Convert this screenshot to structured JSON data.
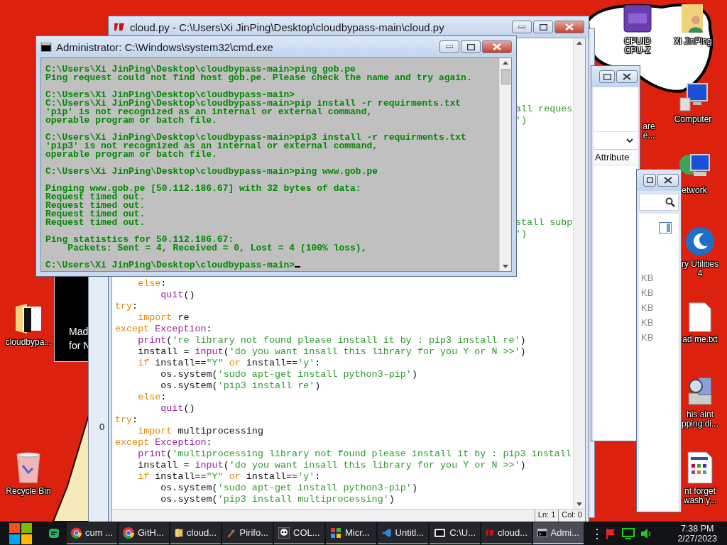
{
  "desktop_icons": [
    {
      "kind": "cpu-chip",
      "label": "CPUID\nCPU-Z"
    },
    {
      "kind": "user-folder",
      "label": "Xi JinPing"
    },
    {
      "kind": "hidden",
      "label": "are\ne..."
    },
    {
      "kind": "computer",
      "label": "Computer"
    },
    {
      "kind": "globe-computer",
      "label": "etwork"
    },
    {
      "kind": "swirl",
      "label": "ry Utilities\n4"
    },
    {
      "kind": "text-file",
      "label": "ad me.txt"
    },
    {
      "kind": "scanner",
      "label": "his aint\npping di..."
    },
    {
      "kind": "document",
      "label": "nt forget\nwash y..."
    },
    {
      "kind": "folder",
      "label": "cloudbypa..."
    },
    {
      "kind": "recycle-bin",
      "label": "Recycle Bin"
    }
  ],
  "background_windows": {
    "promo_text": [
      "Mad",
      "for N"
    ],
    "side_value": "0",
    "attribute_header": "Attribute",
    "sizes": [
      "KB",
      "KB",
      "KB",
      "KB",
      "KB"
    ]
  },
  "editor": {
    "title": "cloud.py - C:\\Users\\Xi JinPing\\Desktop\\cloudbypass-main\\cloud.py",
    "fragments": [
      [
        "all reques",
        "')"
      ],
      [
        "stall subp",
        "')"
      ]
    ],
    "lines": [
      [
        {
          "kind": "keyword",
          "text": "    else"
        },
        {
          "kind": "plain",
          "text": ":"
        }
      ],
      [
        {
          "kind": "builtin",
          "text": "        quit"
        },
        {
          "kind": "plain",
          "text": "()"
        }
      ],
      [
        {
          "kind": "keyword",
          "text": "try"
        },
        {
          "kind": "plain",
          "text": ":"
        }
      ],
      [
        {
          "kind": "keyword",
          "text": "    import"
        },
        {
          "kind": "plain",
          "text": " re"
        }
      ],
      [
        {
          "kind": "keyword",
          "text": "except"
        },
        {
          "kind": "builtin",
          "text": " Exception"
        },
        {
          "kind": "plain",
          "text": ":"
        }
      ],
      [
        {
          "kind": "builtin",
          "text": "    print"
        },
        {
          "kind": "plain",
          "text": "("
        },
        {
          "kind": "string",
          "text": "'re library not found please install it by : pip3 install re'"
        },
        {
          "kind": "plain",
          "text": ")"
        }
      ],
      [
        {
          "kind": "plain",
          "text": "    install = "
        },
        {
          "kind": "builtin",
          "text": "input"
        },
        {
          "kind": "plain",
          "text": "("
        },
        {
          "kind": "string",
          "text": "'do you want insall this library for you Y or N >>'"
        },
        {
          "kind": "plain",
          "text": ")"
        }
      ],
      [
        {
          "kind": "keyword",
          "text": "    if"
        },
        {
          "kind": "plain",
          "text": " install=="
        },
        {
          "kind": "string",
          "text": "\"Y\""
        },
        {
          "kind": "keyword",
          "text": " or"
        },
        {
          "kind": "plain",
          "text": " install=="
        },
        {
          "kind": "string",
          "text": "'y'"
        },
        {
          "kind": "plain",
          "text": ":"
        }
      ],
      [
        {
          "kind": "plain",
          "text": "        os.system("
        },
        {
          "kind": "string",
          "text": "'sudo apt-get install python3-pip'"
        },
        {
          "kind": "plain",
          "text": ")"
        }
      ],
      [
        {
          "kind": "plain",
          "text": "        os.system("
        },
        {
          "kind": "string",
          "text": "'pip3 install re'"
        },
        {
          "kind": "plain",
          "text": ")"
        }
      ],
      [
        {
          "kind": "keyword",
          "text": "    else"
        },
        {
          "kind": "plain",
          "text": ":"
        }
      ],
      [
        {
          "kind": "builtin",
          "text": "        quit"
        },
        {
          "kind": "plain",
          "text": "()"
        }
      ],
      [
        {
          "kind": "keyword",
          "text": "try"
        },
        {
          "kind": "plain",
          "text": ":"
        }
      ],
      [
        {
          "kind": "keyword",
          "text": "    import"
        },
        {
          "kind": "plain",
          "text": " multiprocessing"
        }
      ],
      [
        {
          "kind": "keyword",
          "text": "except"
        },
        {
          "kind": "builtin",
          "text": " Exception"
        },
        {
          "kind": "plain",
          "text": ":"
        }
      ],
      [
        {
          "kind": "builtin",
          "text": "    print"
        },
        {
          "kind": "plain",
          "text": "("
        },
        {
          "kind": "string",
          "text": "'multiprocessing library not found please install it by : pip3 install"
        }
      ],
      [
        {
          "kind": "plain",
          "text": "    install = "
        },
        {
          "kind": "builtin",
          "text": "input"
        },
        {
          "kind": "plain",
          "text": "("
        },
        {
          "kind": "string",
          "text": "'do you want insall this library for you Y or N >>'"
        },
        {
          "kind": "plain",
          "text": ")"
        }
      ],
      [
        {
          "kind": "keyword",
          "text": "    if"
        },
        {
          "kind": "plain",
          "text": " install=="
        },
        {
          "kind": "string",
          "text": "\"Y\""
        },
        {
          "kind": "keyword",
          "text": " or"
        },
        {
          "kind": "plain",
          "text": " install=="
        },
        {
          "kind": "string",
          "text": "'y'"
        },
        {
          "kind": "plain",
          "text": ":"
        }
      ],
      [
        {
          "kind": "plain",
          "text": "        os.system("
        },
        {
          "kind": "string",
          "text": "'sudo apt-get install python3-pip'"
        },
        {
          "kind": "plain",
          "text": ")"
        }
      ],
      [
        {
          "kind": "plain",
          "text": "        os.system("
        },
        {
          "kind": "string",
          "text": "'pip3 install multiprocessing'"
        },
        {
          "kind": "plain",
          "text": ")"
        }
      ]
    ],
    "status": [
      "Ln: 1",
      "Col: 0"
    ]
  },
  "console": {
    "title": "Administrator: C:\\Windows\\system32\\cmd.exe",
    "blocks": [
      [
        "C:\\Users\\Xi JinPing\\Desktop\\cloudbypass-main>ping gob.pe",
        "Ping request could not find host gob.pe. Please check the name and try again."
      ],
      [
        "C:\\Users\\Xi JinPing\\Desktop\\cloudbypass-main>",
        "C:\\Users\\Xi JinPing\\Desktop\\cloudbypass-main>pip install -r requirments.txt",
        "'pip' is not recognized as an internal or external command,",
        "operable program or batch file."
      ],
      [
        "C:\\Users\\Xi JinPing\\Desktop\\cloudbypass-main>pip3 install -r requirments.txt",
        "'pip3' is not recognized as an internal or external command,",
        "operable program or batch file."
      ],
      [
        "C:\\Users\\Xi JinPing\\Desktop\\cloudbypass-main>ping www.gob.pe"
      ],
      [
        "Pinging www.gob.pe [50.112.186.67] with 32 bytes of data:",
        "Request timed out.",
        "Request timed out.",
        "Request timed out.",
        "Request timed out."
      ],
      [
        "Ping statistics for 50.112.186.67:",
        "    Packets: Sent = 4, Received = 0, Lost = 4 (100% loss),"
      ],
      [
        "C:\\Users\\Xi JinPing\\Desktop\\cloudbypass-main>"
      ]
    ]
  },
  "taskbar": {
    "items": [
      {
        "kind": "chrome",
        "label": "cum ...",
        "selected": false
      },
      {
        "kind": "chrome",
        "label": "GitH...",
        "selected": false
      },
      {
        "kind": "folder",
        "label": "cloud...",
        "selected": false
      },
      {
        "kind": "piriform",
        "label": "Pirifo...",
        "selected": false
      },
      {
        "kind": "skull",
        "label": "COL...",
        "selected": false
      },
      {
        "kind": "office",
        "label": "Micr...",
        "selected": false
      },
      {
        "kind": "vscode",
        "label": "Untitl...",
        "selected": false
      },
      {
        "kind": "archive",
        "label": "C:\\U...",
        "selected": false
      },
      {
        "kind": "notepad",
        "label": "cloud...",
        "selected": false
      },
      {
        "kind": "console",
        "label": "Admi...",
        "selected": true
      }
    ],
    "overflow": "⋮",
    "time": "7:38 PM",
    "date": "2/27/2023"
  }
}
